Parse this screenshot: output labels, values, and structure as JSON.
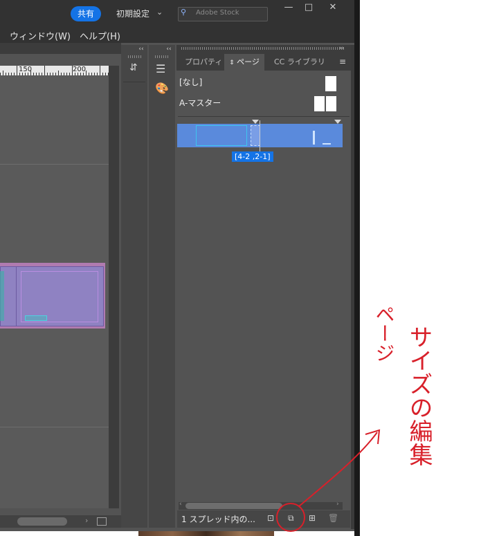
{
  "titlebar": {
    "share_label": "共有",
    "workspace_label": "初期設定",
    "stock_placeholder": "Adobe Stock",
    "minimize": "—",
    "restore": "□",
    "close": "✕"
  },
  "menubar": {
    "items": [
      "ウィンドウ(W)",
      "ヘルプ(H)"
    ]
  },
  "ruler": {
    "labels": [
      "150",
      "200"
    ]
  },
  "panel": {
    "tabs": [
      "プロパティ",
      "ページ",
      "CC ライブラリ"
    ],
    "masters": [
      "[なし]",
      "A-マスター"
    ],
    "page_label": "[4-2 ,2-1]",
    "status": "1 スプレッド内の..."
  },
  "annotation": {
    "text_vertical_1": "ページ",
    "text_vertical_2": "サイズの編集",
    "color": "#d8202a"
  },
  "colors": {
    "app_bg": "#535353",
    "accent": "#1473e6",
    "selected_spread": "#5a8adc"
  }
}
